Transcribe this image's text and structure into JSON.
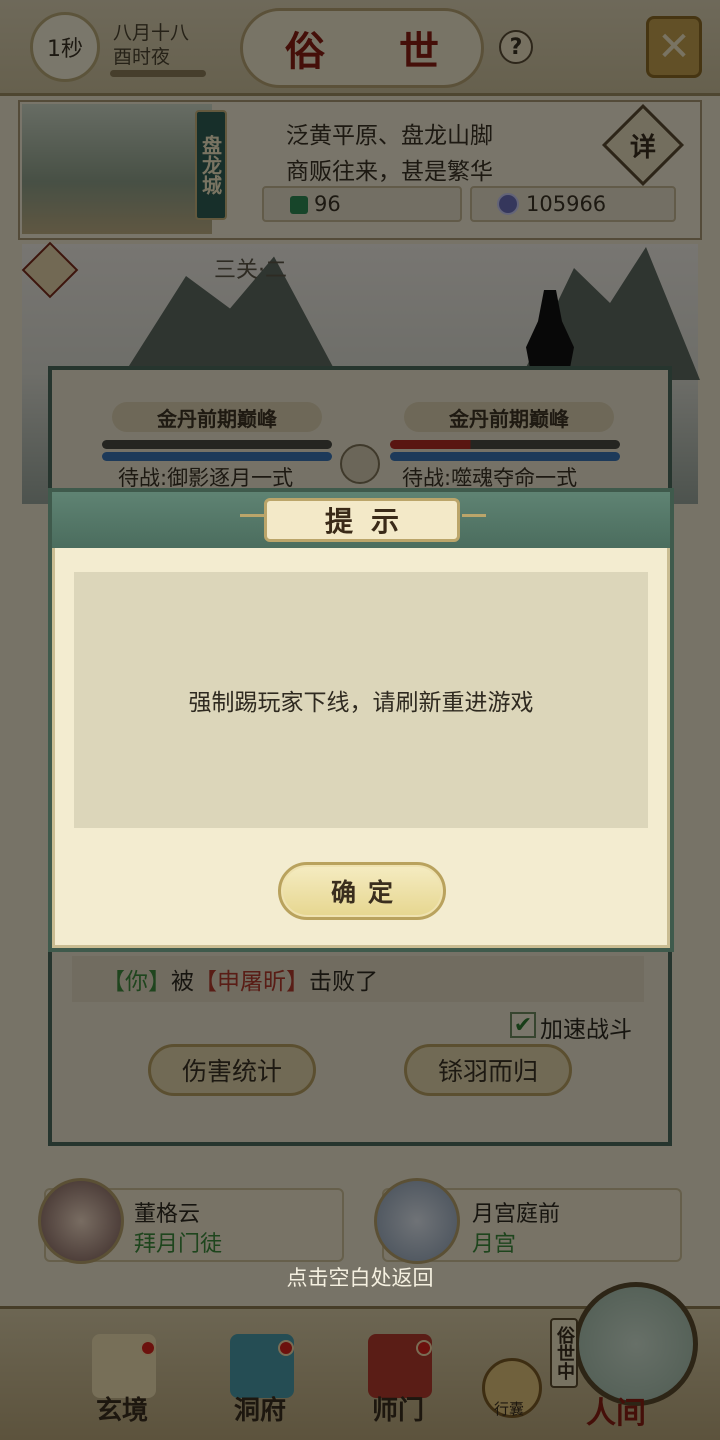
{
  "top": {
    "timer": "1秒",
    "date_line1": "八月十八",
    "date_line2": "酉时夜",
    "title": "俗 世",
    "help": "?"
  },
  "location": {
    "city_tag": "盘龙城",
    "line1": "泛黄平原、盘龙山脚",
    "line2": "商贩往来，甚是繁华",
    "detail": "详",
    "currency1": "96",
    "currency2": "105966"
  },
  "battle": {
    "stage": "三关·二",
    "left_level": "金丹前期巅峰",
    "right_level": "金丹前期巅峰",
    "left_wait": "待战:御影逐月一式",
    "right_wait": "待战:噬魂夺命一式",
    "log_you": "【你】",
    "log_by": "被",
    "log_enemy": "【申屠昕】",
    "log_end": "击败了",
    "speed_label": "加速战斗",
    "damage_stats": "伤害统计",
    "retreat": "铩羽而归"
  },
  "npcs": [
    {
      "name": "董格云",
      "sub": "拜月门徒"
    },
    {
      "name": "月宫庭前",
      "sub": "月宫"
    }
  ],
  "back_hint": "点击空白处返回",
  "nav": {
    "xuanjing": "玄境",
    "dongfu": "洞府",
    "shimen": "师门",
    "xingnang": "行囊",
    "sushi": "俗世中",
    "renjian": "人间"
  },
  "modal": {
    "title": "提示",
    "message": "强制踢玩家下线，请刷新重进游戏",
    "confirm": "确定"
  },
  "colors": {
    "modal_header": "#4b6d5e",
    "accent_red": "#8a1f12",
    "panel_bg": "#f3ecd0"
  }
}
